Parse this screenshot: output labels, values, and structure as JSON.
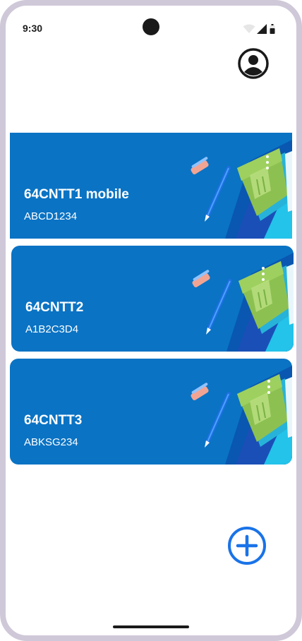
{
  "status_bar": {
    "time": "9:30"
  },
  "classes": [
    {
      "name": "64CNTT1 mobile",
      "code": "ABCD1234"
    },
    {
      "name": "64CNTT2",
      "code": "A1B2C3D4"
    },
    {
      "name": "64CNTT3",
      "code": "ABKSG234"
    }
  ],
  "colors": {
    "card_bg": "#0a73c4",
    "fab": "#1a73e8",
    "frame": "#cfc8d8"
  },
  "icons": {
    "profile": "account-circle-icon",
    "add": "add-circle-icon",
    "menu": "more-vert-icon"
  }
}
